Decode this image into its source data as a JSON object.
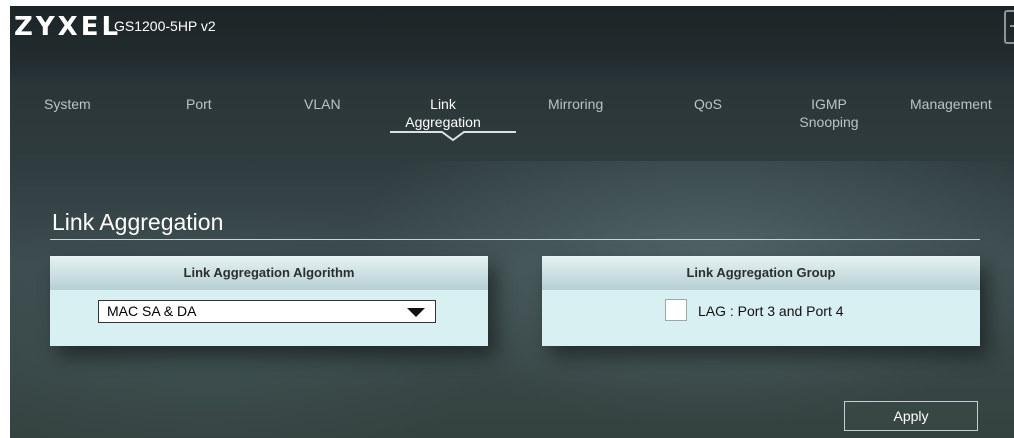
{
  "header": {
    "logo": "ZYXEL",
    "model": "GS1200-5HP v2",
    "icons": {
      "logout": "logout-icon"
    }
  },
  "nav": {
    "active": "link-aggregation",
    "tabs": [
      {
        "id": "system",
        "label": "System"
      },
      {
        "id": "port",
        "label": "Port"
      },
      {
        "id": "vlan",
        "label": "VLAN"
      },
      {
        "id": "link-aggregation",
        "label_line1": "Link",
        "label_line2": "Aggregation"
      },
      {
        "id": "mirroring",
        "label": "Mirroring"
      },
      {
        "id": "qos",
        "label": "QoS"
      },
      {
        "id": "igmp-snooping",
        "label_line1": "IGMP",
        "label_line2": "Snooping"
      },
      {
        "id": "management",
        "label": "Management"
      }
    ]
  },
  "main": {
    "title": "Link Aggregation",
    "algorithm_panel": {
      "heading": "Link Aggregation Algorithm",
      "selected": "MAC SA & DA"
    },
    "group_panel": {
      "heading": "Link Aggregation Group",
      "checkbox_label": "LAG : Port 3 and Port 4",
      "checked": false
    },
    "apply_label": "Apply"
  },
  "colors": {
    "panel_body": "#d8f0f2",
    "panel_head": "#b7cfd3",
    "background": "#2c393c"
  }
}
